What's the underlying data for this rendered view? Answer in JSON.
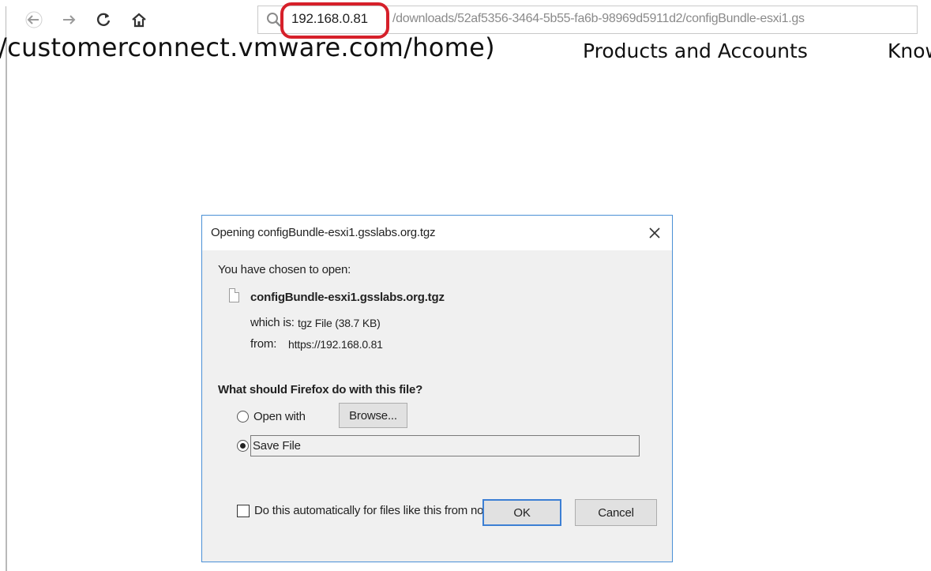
{
  "browser": {
    "back_icon": "arrow-left-icon",
    "forward_icon": "arrow-right-icon",
    "reload_icon": "reload-icon",
    "home_icon": "home-icon",
    "url_host": "192.168.0.81",
    "url_path": "/downloads/52af5356-3464-5b55-fa6b-98969d5911d2/configBundle-esxi1.gs",
    "highlight_color": "#d6202a"
  },
  "vmware_header": {
    "url_text": "/customerconnect.vmware.com/home)",
    "nav_products": "Products and Accounts",
    "nav_know": "Know"
  },
  "dialog": {
    "title": "Opening configBundle-esxi1.gsslabs.org.tgz",
    "chosen_label": "You have chosen to open:",
    "file_name": "configBundle-esxi1.gsslabs.org.tgz",
    "which_is_label": "which is:",
    "which_is_value": "tgz File (38.7 KB)",
    "from_label": "from:",
    "from_value": "https://192.168.0.81",
    "question": "What should Firefox do with this file?",
    "open_with_label": "Open with",
    "browse_label": "Browse...",
    "save_file_label": "Save File",
    "selected_option": "Save File",
    "auto_label": "Do this automatically for files like this from now on.",
    "auto_checked": false,
    "ok_label": "OK",
    "cancel_label": "Cancel",
    "accent_color": "#3c7fd4"
  }
}
